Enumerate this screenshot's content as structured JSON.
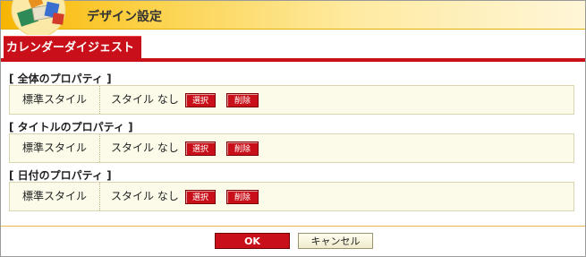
{
  "window": {
    "title": "デザイン設定"
  },
  "tab": {
    "label": "カレンダーダイジェスト"
  },
  "sections": [
    {
      "title": "[ 全体のプロパティ ]",
      "label": "標準スタイル",
      "value": "スタイル なし",
      "select_label": "選択",
      "delete_label": "削除"
    },
    {
      "title": "[ タイトルのプロパティ ]",
      "label": "標準スタイル",
      "value": "スタイル なし",
      "select_label": "選択",
      "delete_label": "削除"
    },
    {
      "title": "[ 日付のプロパティ ]",
      "label": "標準スタイル",
      "value": "スタイル なし",
      "select_label": "選択",
      "delete_label": "削除"
    }
  ],
  "footer": {
    "ok_label": "OK",
    "cancel_label": "キャンセル"
  },
  "colors": {
    "accent_red": "#c9101a",
    "title_gold": "#f7b500",
    "panel_bg": "#fcfbea"
  },
  "icons": {
    "app_logo": "app-logo-icon"
  }
}
